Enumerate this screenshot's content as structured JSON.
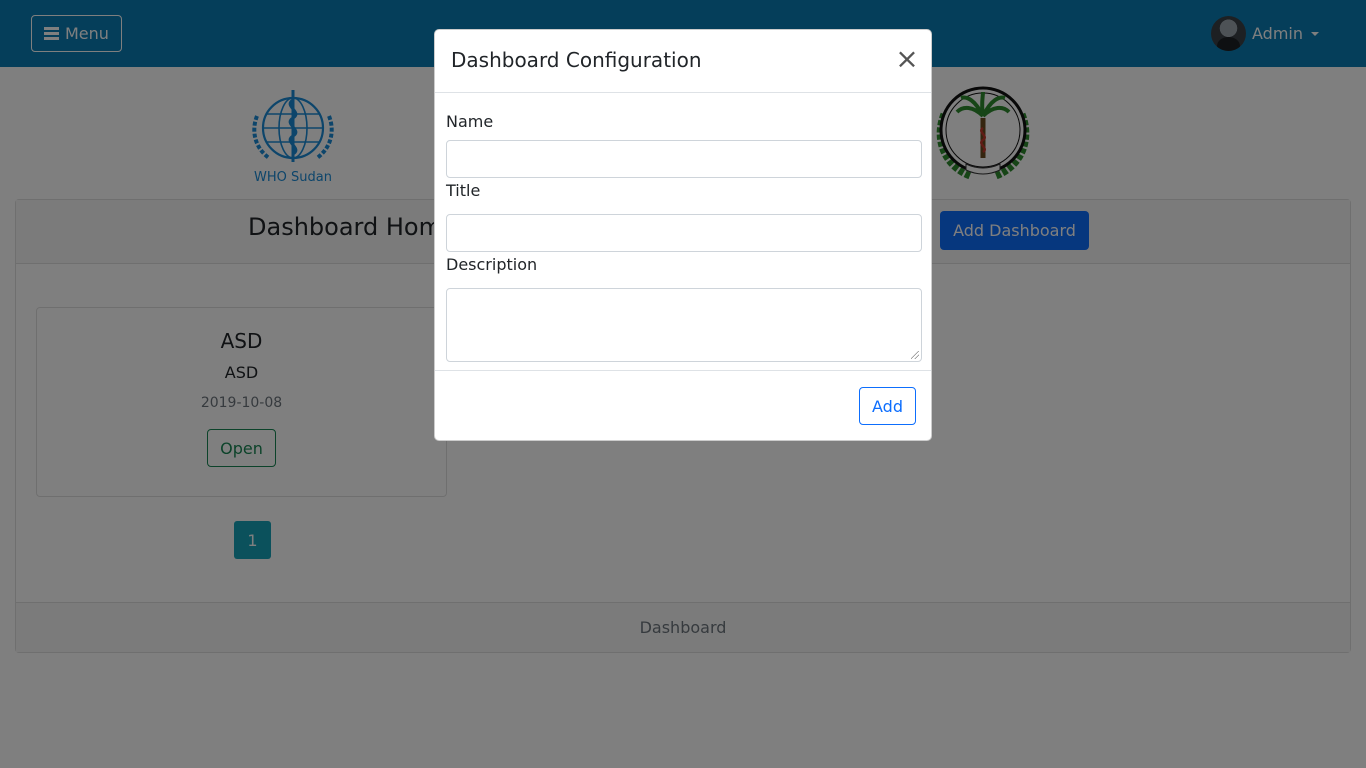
{
  "topbar": {
    "menu_label": "Menu",
    "user_name": "Admin"
  },
  "logos": {
    "who_text": "WHO Sudan"
  },
  "main": {
    "title": "Dashboard Home",
    "add_button": "Add Dashboard",
    "dashboards": [
      {
        "name": "ASD",
        "title": "ASD",
        "date": "2019-10-08",
        "open_label": "Open"
      }
    ],
    "pagination": {
      "current_page": "1"
    },
    "footer": "Dashboard"
  },
  "modal": {
    "title": "Dashboard Configuration",
    "close_symbol": "×",
    "fields": {
      "name": {
        "label": "Name",
        "value": ""
      },
      "title": {
        "label": "Title",
        "value": ""
      },
      "description": {
        "label": "Description",
        "value": ""
      }
    },
    "submit_label": "Add"
  },
  "colors": {
    "topbar": "#0a7db5",
    "primary": "#0d6efd",
    "success": "#198754",
    "info": "#17a2b8"
  }
}
